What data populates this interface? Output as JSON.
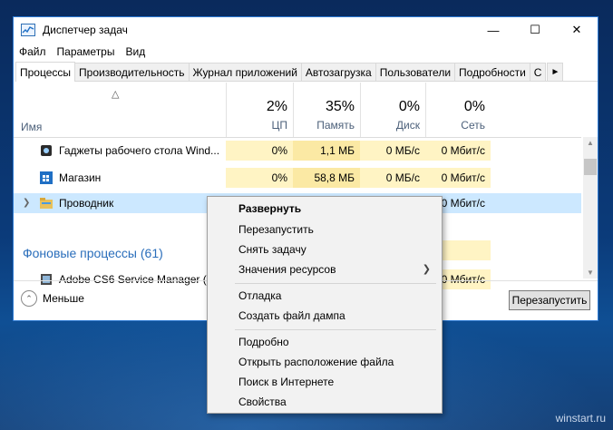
{
  "window": {
    "title": "Диспетчер задач"
  },
  "menu": [
    "Файл",
    "Параметры",
    "Вид"
  ],
  "tabs": [
    "Процессы",
    "Производительность",
    "Журнал приложений",
    "Автозагрузка",
    "Пользователи",
    "Подробности",
    "С"
  ],
  "columns": {
    "name": "Имя",
    "cpu": {
      "pct": "2%",
      "label": "ЦП"
    },
    "mem": {
      "pct": "35%",
      "label": "Память"
    },
    "disk": {
      "pct": "0%",
      "label": "Диск"
    },
    "net": {
      "pct": "0%",
      "label": "Сеть"
    }
  },
  "rows": [
    {
      "name": "Гаджеты рабочего стола Wind...",
      "cpu": "0%",
      "mem": "1,1 МБ",
      "disk": "0 МБ/с",
      "net": "0 Мбит/с"
    },
    {
      "name": "Магазин",
      "cpu": "0%",
      "mem": "58,8 МБ",
      "disk": "0 МБ/с",
      "net": "0 Мбит/с"
    },
    {
      "name": "Проводник",
      "net": "0 Мбит/с"
    },
    {
      "name": "Adobe CS6 Service Manager (3...",
      "net": "0 Мбит/с"
    }
  ],
  "group_label": "Фоновые процессы (61)",
  "footer": {
    "less": "Меньше",
    "restart": "Перезапустить"
  },
  "context_menu": {
    "expand": "Развернуть",
    "restart": "Перезапустить",
    "end_task": "Снять задачу",
    "resource_values": "Значения ресурсов",
    "debug": "Отладка",
    "dump": "Создать файл дампа",
    "details": "Подробно",
    "open_location": "Открыть расположение файла",
    "search_web": "Поиск в Интернете",
    "properties": "Свойства"
  },
  "watermark": "winstart.ru",
  "icons": {
    "app": "task-manager-icon",
    "minimize": "minimize-icon",
    "maximize": "maximize-icon",
    "close": "close-icon"
  }
}
